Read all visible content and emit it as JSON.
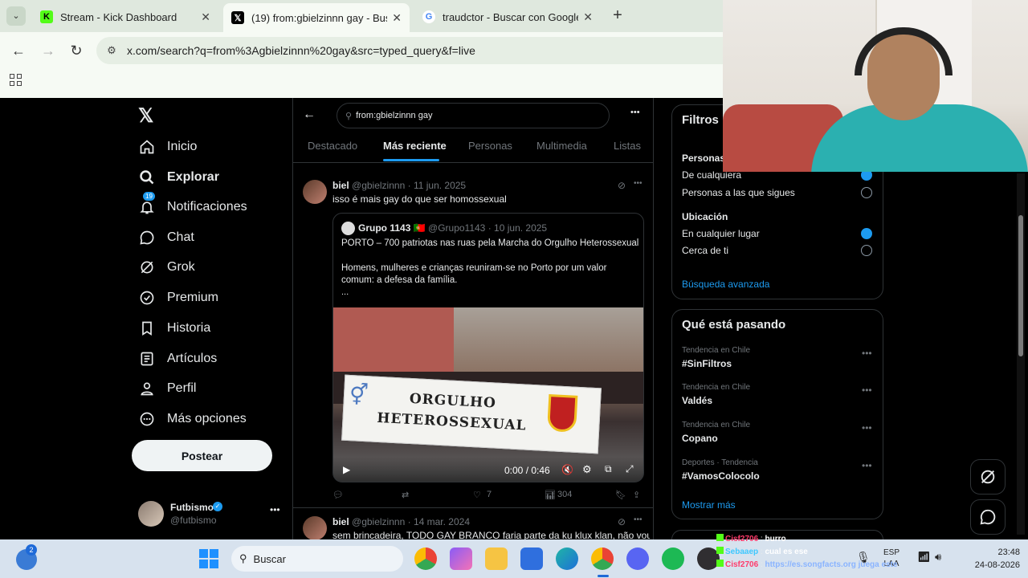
{
  "browser": {
    "tabs": [
      {
        "title": "Stream - Kick Dashboard",
        "icon": "kick-icon",
        "active": false
      },
      {
        "title": "(19) from:gbielzinnn gay - Busc",
        "icon": "x-icon",
        "active": true
      },
      {
        "title": "traudctor - Buscar con Google",
        "icon": "google-icon",
        "active": false
      }
    ],
    "new_tab": "+",
    "url": "x.com/search?q=from%3Agbielzinnn%20gay&src=typed_query&f=live"
  },
  "sidebar": {
    "items": [
      {
        "label": "Inicio",
        "icon": "home-icon"
      },
      {
        "label": "Explorar",
        "icon": "search-icon"
      },
      {
        "label": "Notificaciones",
        "icon": "bell-icon",
        "badge": "19"
      },
      {
        "label": "Chat",
        "icon": "chat-icon"
      },
      {
        "label": "Grok",
        "icon": "grok-icon"
      },
      {
        "label": "Premium",
        "icon": "premium-icon"
      },
      {
        "label": "Historia",
        "icon": "bookmark-icon"
      },
      {
        "label": "Artículos",
        "icon": "article-icon"
      },
      {
        "label": "Perfil",
        "icon": "person-icon"
      },
      {
        "label": "Más opciones",
        "icon": "more-circle-icon"
      }
    ],
    "post_button": "Postear",
    "account": {
      "name": "Futbismo",
      "handle": "@futbismo"
    }
  },
  "search": {
    "query": "from:gbielzinnn gay",
    "tabs": [
      "Destacado",
      "Más reciente",
      "Personas",
      "Multimedia",
      "Listas"
    ],
    "selected_tab": "Más reciente"
  },
  "tweets": [
    {
      "name": "biel",
      "handle": "@gbielzinnn",
      "date": "11 jun. 2025",
      "text": "isso é mais gay do que ser homossexual",
      "quote": {
        "name": "Grupo 1143",
        "flag": "🇵🇹",
        "handle": "@Grupo1143",
        "date": "10 jun. 2025",
        "line1": "PORTO – 700 patriotas nas ruas pela Marcha do Orgulho Heterossexual",
        "line2": "Homens, mulheres e crianças reuniram-se no Porto por um valor comum: a defesa da família.",
        "more": "...",
        "banner": "ORGULHO HETEROSSEXUAL",
        "video_time": "0:00 / 0:46"
      },
      "likes": "7",
      "views": "304"
    },
    {
      "name": "biel",
      "handle": "@gbielzinnn",
      "date": "14 mar. 2024",
      "text": "sem brincadeira, TODO GAY BRANCO faria parte da ku klux klan, não vou"
    }
  ],
  "filters": {
    "title": "Filtros",
    "people_label": "Personas",
    "people_opts": [
      "De cualquiera",
      "Personas a las que sigues"
    ],
    "location_label": "Ubicación",
    "location_opts": [
      "En cualquier lugar",
      "Cerca de ti"
    ],
    "advanced": "Búsqueda avanzada"
  },
  "trends": {
    "title": "Qué está pasando",
    "items": [
      {
        "cat": "Tendencia en Chile",
        "tag": "#SinFiltros"
      },
      {
        "cat": "Tendencia en Chile",
        "tag": "Valdés"
      },
      {
        "cat": "Tendencia en Chile",
        "tag": "Copano"
      },
      {
        "cat": "Deportes · Tendencia",
        "tag": "#VamosColocolo"
      }
    ],
    "show_more": "Mostrar más"
  },
  "chat_overlay": [
    {
      "user": "Cisf2706",
      "msg": "burro"
    },
    {
      "user": "Sebaaep",
      "msg": "cual es ese"
    },
    {
      "user": "Cisf2706",
      "msg": "https://es.songfacts.org juega este"
    }
  ],
  "taskbar": {
    "search": "Buscar",
    "badge": "2",
    "lang1": "ESP",
    "lang2": "LAA",
    "time": "23:48",
    "date": "24-08-2026"
  },
  "colors": {
    "accent": "#1d9bf0",
    "x_bg": "#000000",
    "chrome": "#dfe8de"
  }
}
